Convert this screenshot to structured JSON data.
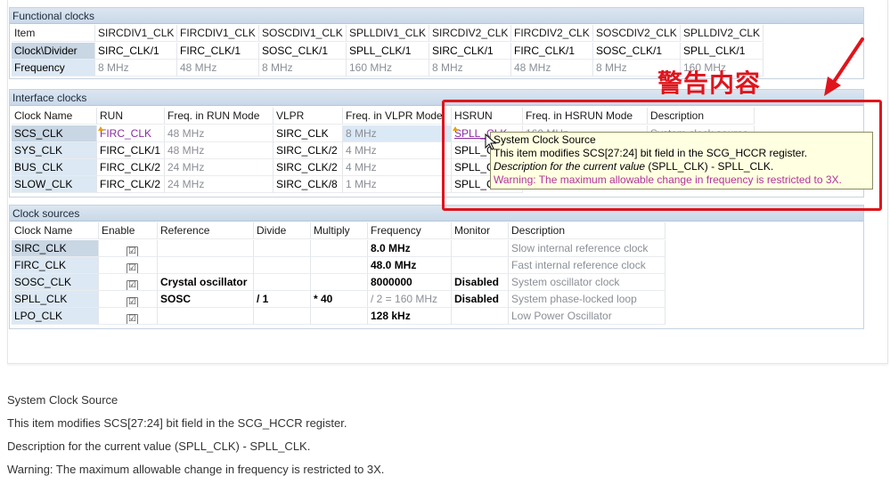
{
  "functional": {
    "title": "Functional clocks",
    "columns": [
      "Item",
      "SIRCDIV1_CLK",
      "FIRCDIV1_CLK",
      "SOSCDIV1_CLK",
      "SPLLDIV1_CLK",
      "SIRCDIV2_CLK",
      "FIRCDIV2_CLK",
      "SOSCDIV2_CLK",
      "SPLLDIV2_CLK"
    ],
    "rows": [
      {
        "label": "Clock\\Divider",
        "values": [
          "SIRC_CLK/1",
          "FIRC_CLK/1",
          "SOSC_CLK/1",
          "SPLL_CLK/1",
          "SIRC_CLK/1",
          "FIRC_CLK/1",
          "SOSC_CLK/1",
          "SPLL_CLK/1"
        ]
      },
      {
        "label": "Frequency",
        "values": [
          "8 MHz",
          "48 MHz",
          "8 MHz",
          "160 MHz",
          "8 MHz",
          "48 MHz",
          "8 MHz",
          "160 MHz"
        ]
      }
    ]
  },
  "interface": {
    "title": "Interface clocks",
    "columns": [
      "Clock Name",
      "RUN",
      "Freq. in RUN Mode",
      "VLPR",
      "Freq. in VLPR Mode",
      "HSRUN",
      "Freq. in HSRUN Mode",
      "Description"
    ],
    "rows": [
      {
        "name": "SCS_CLK",
        "run": "FIRC_CLK",
        "run_freq": "48 MHz",
        "vlpr": "SIRC_CLK",
        "vlpr_freq": "8 MHz",
        "hsrun": "SPLL_CLK",
        "hsrun_freq": "160 MHz",
        "desc": "System clock source"
      },
      {
        "name": "SYS_CLK",
        "run": "FIRC_CLK/1",
        "run_freq": "48 MHz",
        "vlpr": "SIRC_CLK/2",
        "vlpr_freq": "4 MHz",
        "hsrun": "SPLL_CLK",
        "hsrun_freq": "",
        "desc": ""
      },
      {
        "name": "BUS_CLK",
        "run": "FIRC_CLK/2",
        "run_freq": "24 MHz",
        "vlpr": "SIRC_CLK/2",
        "vlpr_freq": "4 MHz",
        "hsrun": "SPLL_CLK",
        "hsrun_freq": "",
        "desc": ""
      },
      {
        "name": "SLOW_CLK",
        "run": "FIRC_CLK/2",
        "run_freq": "24 MHz",
        "vlpr": "SIRC_CLK/8",
        "vlpr_freq": "1 MHz",
        "hsrun": "SPLL_CLK",
        "hsrun_freq": "",
        "desc": ""
      }
    ]
  },
  "sources": {
    "title": "Clock sources",
    "columns": [
      "Clock Name",
      "Enable",
      "Reference",
      "Divide",
      "Multiply",
      "Frequency",
      "Monitor",
      "Description"
    ],
    "rows": [
      {
        "name": "SIRC_CLK",
        "enable": "☑",
        "reference": "",
        "divide": "",
        "multiply": "",
        "frequency": "8.0 MHz",
        "monitor": "",
        "desc": "Slow internal reference clock"
      },
      {
        "name": "FIRC_CLK",
        "enable": "☑",
        "reference": "",
        "divide": "",
        "multiply": "",
        "frequency": "48.0 MHz",
        "monitor": "",
        "desc": "Fast internal reference clock"
      },
      {
        "name": "SOSC_CLK",
        "enable": "☑",
        "reference": "Crystal oscillator",
        "divide": "",
        "multiply": "",
        "frequency": "8000000",
        "monitor": "Disabled",
        "desc": "System oscillator clock"
      },
      {
        "name": "SPLL_CLK",
        "enable": "☑",
        "reference": "SOSC",
        "divide": "/ 1",
        "multiply": "* 40",
        "frequency": "/ 2 = 160 MHz",
        "monitor": "Disabled",
        "desc": "System phase-locked loop"
      },
      {
        "name": "LPO_CLK",
        "enable": "☑",
        "reference": "",
        "divide": "",
        "multiply": "",
        "frequency": "128 kHz",
        "monitor": "",
        "desc": "Low Power Oscillator"
      }
    ]
  },
  "tooltip": {
    "line1": "System Clock Source",
    "line2": "This item modifies SCS[27:24] bit field in the SCG_HCCR register.",
    "line3_italic": "Description for the current value",
    "line3_rest": " (SPLL_CLK) - SPLL_CLK.",
    "line4": "Warning: The maximum allowable change in frequency is restricted to 3X."
  },
  "annotation": {
    "label": "警告内容",
    "color": "#e0141c"
  },
  "caption": [
    "System Clock Source",
    "This item modifies SCS[27:24] bit field in the SCG_HCCR register.",
    "Description for the current value (SPLL_CLK) - SPLL_CLK.",
    "Warning: The maximum allowable change in frequency is restricted to 3X."
  ]
}
